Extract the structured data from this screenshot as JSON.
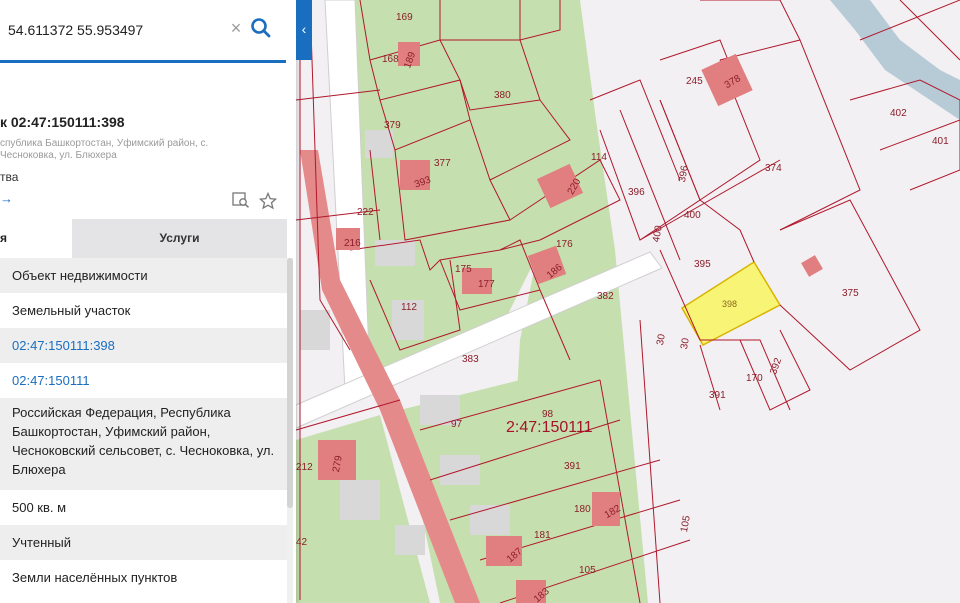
{
  "search": {
    "value": "54.611372 55.953497",
    "clear_glyph": "×",
    "collapse_glyph": "‹"
  },
  "card": {
    "title": "к 02:47:150111:398",
    "address": "спублика Башкортостан, Уфимский район, с. Чесноковка, ул. Блюхера",
    "status": "тва",
    "link_glyph": "→"
  },
  "tabs": [
    {
      "label": "я"
    },
    {
      "label": "Услуги"
    }
  ],
  "info_rows": [
    {
      "text": "Объект недвижимости"
    },
    {
      "text": "Земельный участок"
    },
    {
      "text": "02:47:150111:398"
    },
    {
      "text": "02:47:150111"
    },
    {
      "text": "Российская Федерация, Республика Башкортостан, Уфимский район, Чесноковский сельсовет, с. Чесноковка, ул. Блюхера"
    },
    {
      "text": "500 кв. м"
    },
    {
      "text": "Учтенный"
    },
    {
      "text": "Земли населённых пунктов"
    }
  ],
  "map": {
    "quarter_label": "2:47:150111",
    "highlight_color": "#f7f476",
    "parcel_line_color": "#b0182c",
    "building_color": "#e17f80",
    "green_color": "#c6dfae",
    "parcel_labels": [
      "169",
      "168",
      "189",
      "380",
      "379",
      "377",
      "393",
      "222",
      "216",
      "114",
      "220",
      "176",
      "175",
      "177",
      "186",
      "112",
      "382",
      "383",
      "97",
      "98",
      "391",
      "212",
      "279",
      "42",
      "180",
      "182",
      "181",
      "187",
      "105",
      "183",
      "245",
      "378",
      "402",
      "401",
      "374",
      "396",
      "396",
      "400",
      "400",
      "395",
      "375",
      "398",
      "30",
      "30",
      "170",
      "392",
      "391",
      "105"
    ]
  },
  "colors": {
    "accent": "#1a6ec0"
  }
}
